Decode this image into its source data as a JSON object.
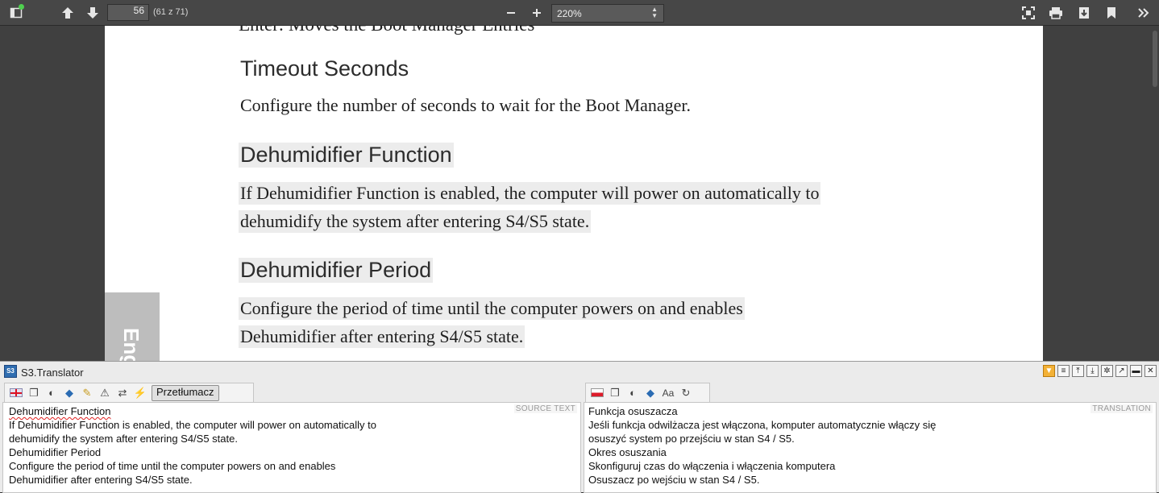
{
  "toolbar": {
    "page_number": "56",
    "page_count": "(61 z 71)",
    "zoom": "220%"
  },
  "document": {
    "cut_line": "Enter: Moves the Boot Manager Entries",
    "sections": [
      {
        "heading": "Timeout Seconds",
        "lines": [
          "Configure the number of seconds to wait for the Boot Manager."
        ]
      },
      {
        "heading": "Dehumidifier Function",
        "lines": [
          "If Dehumidifier Function is enabled, the computer will power on automatically to",
          "dehumidify the system after entering S4/S5 state."
        ]
      },
      {
        "heading": "Dehumidifier Period",
        "lines": [
          "Configure the period of time until the computer powers on and enables",
          "Dehumidifier after entering S4/S5 state."
        ]
      }
    ],
    "side_tab": "Eng"
  },
  "translator": {
    "title": "S3.Translator",
    "translate_button": "Przetłumacz",
    "source_label": "SOURCE TEXT",
    "translation_label": "TRANSLATION",
    "source_lines": [
      "Dehumidifier Function",
      "If Dehumidifier Function is enabled, the computer will power on automatically to",
      "dehumidify the system after entering S4/S5 state.",
      "Dehumidifier Period",
      "Configure the period of time until the computer powers on and enables",
      "Dehumidifier after entering S4/S5 state."
    ],
    "translation_lines": [
      "Funkcja osuszacza",
      "Jeśli funkcja odwilżacza jest włączona, komputer automatycznie włączy się",
      "osuszyć system po przejściu w stan S4 / S5.",
      "Okres osuszania",
      "Skonfiguruj czas do włączenia i włączenia komputera",
      "Osuszacz po wejściu w stan S4 / S5."
    ]
  }
}
